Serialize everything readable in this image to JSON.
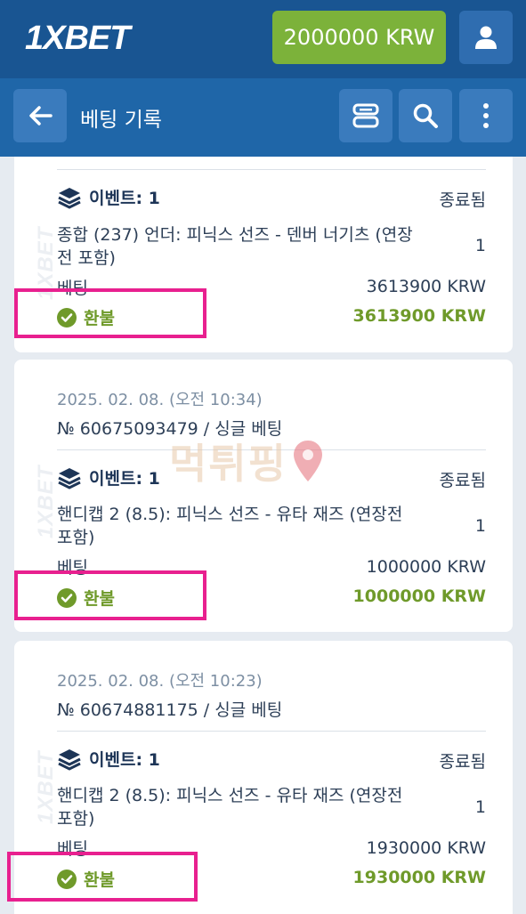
{
  "app": {
    "logo": "1XBET",
    "balance": "2000000 KRW",
    "user_icon": "user-icon"
  },
  "header": {
    "title": "베팅 기록",
    "back_icon": "arrow-left-icon",
    "actions": [
      "layout-toggle-icon",
      "search-icon",
      "more-vertical-icon"
    ]
  },
  "watermark": {
    "side_text": "1XBET",
    "center_text": "먹튀핑"
  },
  "bets": [
    {
      "date": "",
      "number": "",
      "events_label": "이벤트: 1",
      "status": "종료됨",
      "market": "종합 (237) 언더: 피닉스 선즈 - 덴버 너기츠 (연장전 포함)",
      "odds": "1",
      "stake_label": "베팅",
      "stake": "3613900 KRW",
      "result": "환불",
      "payout": "3613900 KRW"
    },
    {
      "date": "2025. 02. 08. (오전 10:34)",
      "number": "№ 60675093479 / 싱글 베팅",
      "events_label": "이벤트: 1",
      "status": "종료됨",
      "market": "핸디캡 2 (8.5): 피닉스 선즈 - 유타 재즈 (연장전 포함)",
      "odds": "1",
      "stake_label": "베팅",
      "stake": "1000000 KRW",
      "result": "환불",
      "payout": "1000000 KRW"
    },
    {
      "date": "2025. 02. 08. (오전 10:23)",
      "number": "№ 60674881175 / 싱글 베팅",
      "events_label": "이벤트: 1",
      "status": "종료됨",
      "market": "핸디캡 2 (8.5): 피닉스 선즈 - 유타 재즈 (연장전 포함)",
      "odds": "1",
      "stake_label": "베팅",
      "stake": "1930000 KRW",
      "result": "환불",
      "payout": "1930000 KRW"
    }
  ],
  "colors": {
    "topbar": "#195592",
    "header": "#1f66a8",
    "balance_bg": "#7cb23a",
    "success": "#6f9a2a",
    "highlight": "#e8208f"
  }
}
